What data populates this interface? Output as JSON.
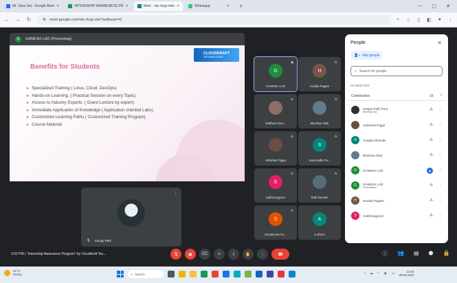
{
  "browser": {
    "tabs": [
      {
        "title": "Mr. Vasu Sai - Google Meet",
        "color": "#1a73e8",
        "active": false
      },
      {
        "title": "INTERNSHIP AWARENESS PR",
        "color": "#0f9d58",
        "active": false
      },
      {
        "title": "Meet - vkc-fuzp-mkn",
        "color": "#00897b",
        "active": true
      },
      {
        "title": "Whatsapp",
        "color": "#25d366",
        "active": false
      }
    ],
    "url": "meet.google.com/vkc-fuzp-xkn?authuser=0"
  },
  "meeting": {
    "presenter_initial": "G",
    "presenter_label": "GANESH LAD (Presenting)",
    "info": "2:02 PM  |  \"Internship Awareness Program\" by Cloudkraft Tec..."
  },
  "slide": {
    "title": "Benefits for Students",
    "logo_text": "CLOUDKRAFT",
    "logo_sub": "TECHNOLOGIES",
    "bullets": [
      "Specialized Training ( Linux, Cloud, DevOps).",
      "Hands-on Learning. ( Practical Session on every Topic).",
      "Access to Industry Experts. ( Guest Lecture by expert).",
      "Immediate Application of Knowledge ( Application oriented Labs).",
      "Customized Learning Paths ( Customized Training Program).",
      "Course Material"
    ]
  },
  "self_tile": {
    "name": "Sanjay Patil"
  },
  "tiles": [
    {
      "name": "GANESH LAD",
      "initial": "G",
      "color": "#1e8e3e",
      "active": true
    },
    {
      "name": "Hrutika Pagare",
      "initial": "H",
      "color": "#795548",
      "active": false
    },
    {
      "name": "Vaibhavi Daru...",
      "initial": "",
      "color": "#8d6e63",
      "active": false
    },
    {
      "name": "Bhushan Mali",
      "initial": "",
      "color": "#607d8b",
      "active": false
    },
    {
      "name": "Abhishek Pagar",
      "initial": "",
      "color": "#6d4c41",
      "active": false
    },
    {
      "name": "Samruddhi Pa...",
      "initial": "S",
      "color": "#00897b",
      "active": false
    },
    {
      "name": "Sukhmeyjyoon",
      "initial": "S",
      "color": "#e91e63",
      "active": false
    },
    {
      "name": "Ruth Norvele",
      "initial": "",
      "color": "#546e7a",
      "active": false
    },
    {
      "name": "SHUBHAM TH...",
      "initial": "S",
      "color": "#e65100",
      "active": false
    },
    {
      "name": "5 others",
      "initial": "A",
      "color": "#00897b",
      "active": false
    }
  ],
  "people_panel": {
    "title": "People",
    "add_people": "Add people",
    "search_placeholder": "Search for people",
    "section_label": "IN MEETING",
    "contributors_label": "Contributors",
    "contributors_count": "15",
    "people": [
      {
        "name": "Sanjay Patil (You)",
        "sub": "Meeting host",
        "initial": "",
        "color": "#263238",
        "speaking": false
      },
      {
        "name": "Abhishek Pagar",
        "sub": "",
        "initial": "",
        "color": "#6d4c41",
        "speaking": false
      },
      {
        "name": "Anagha Shevale",
        "sub": "",
        "initial": "A",
        "color": "#00897b",
        "speaking": false
      },
      {
        "name": "Bhushan Mali",
        "sub": "",
        "initial": "",
        "color": "#607d8b",
        "speaking": false
      },
      {
        "name": "GANESH LAD",
        "sub": "",
        "initial": "G",
        "color": "#1e8e3e",
        "speaking": true
      },
      {
        "name": "GANESH LAD",
        "sub": "Presentation",
        "initial": "G",
        "color": "#1e8e3e",
        "speaking": false
      },
      {
        "name": "Hrutika Pagare",
        "sub": "",
        "initial": "H",
        "color": "#795548",
        "speaking": false
      },
      {
        "name": "Sukhmeyjyoon",
        "sub": "",
        "initial": "S",
        "color": "#e91e63",
        "speaking": false
      }
    ]
  },
  "taskbar": {
    "weather_temp": "31°C",
    "weather_desc": "Sunny",
    "search_label": "Search",
    "time": "14:02",
    "date": "29-03-2024"
  }
}
